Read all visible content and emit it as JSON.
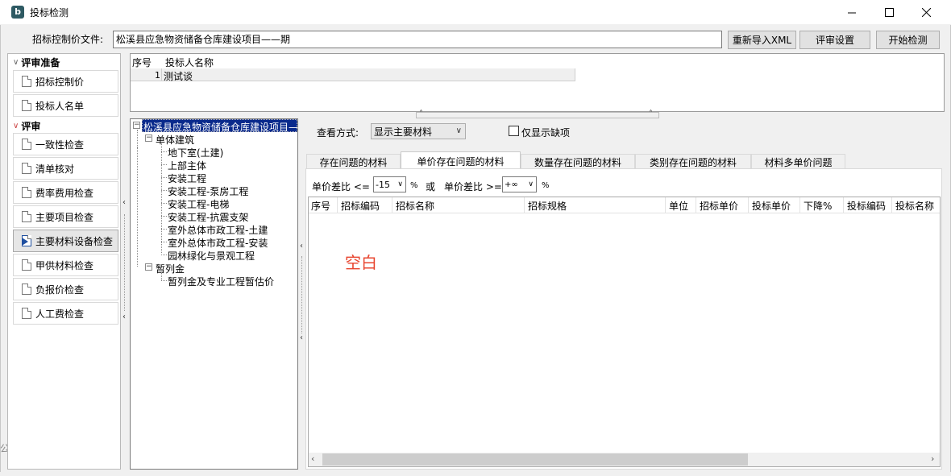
{
  "window": {
    "title": "投标检测",
    "app_icon_letter": "b"
  },
  "file_row": {
    "label": "招标控制价文件:",
    "value": "松溪县应急物资储备仓库建设项目——期",
    "btn_reimport": "重新导入XML",
    "btn_settings": "评审设置",
    "btn_start": "开始检测"
  },
  "leftnav": {
    "section1": "评审准备",
    "section1_items": [
      "招标控制价",
      "投标人名单"
    ],
    "section2": "评审",
    "section2_items": [
      "一致性检查",
      "清单核对",
      "费率费用检查",
      "主要项目检查",
      "主要材料设备检查",
      "甲供材料检查",
      "负报价检查",
      "人工费检查"
    ],
    "active_index": 4
  },
  "topgrid": {
    "headers": [
      "序号",
      "投标人名称"
    ],
    "rows": [
      {
        "seq": "1",
        "name": "测试谈"
      }
    ]
  },
  "tree": {
    "root": "松溪县应急物资储备仓库建设项目—",
    "group1": "单体建筑",
    "group1_items": [
      "地下室(土建)",
      "上部主体",
      "安装工程",
      "安装工程-泵房工程",
      "安装工程-电梯",
      "安装工程-抗震支架",
      "室外总体市政工程-土建",
      "室外总体市政工程-安装",
      "园林绿化与景观工程"
    ],
    "group2": "暂列金",
    "group2_items": [
      "暂列金及专业工程暂估价"
    ]
  },
  "view": {
    "label": "查看方式:",
    "selected": "显示主要材料",
    "only_missing": "仅显示缺项",
    "only_missing_checked": false
  },
  "tabs": [
    "存在问题的材料",
    "单价存在问题的材料",
    "数量存在问题的材料",
    "类别存在问题的材料",
    "材料多单价问题"
  ],
  "active_tab": 1,
  "filter": {
    "label1": "单价差比  <=",
    "value1": "-15",
    "pct": "%",
    "or": "或",
    "label2": "单价差比  >=",
    "value2": "+∞"
  },
  "grid": {
    "headers": [
      "序号",
      "招标编码",
      "招标名称",
      "招标规格",
      "单位",
      "招标单价",
      "投标单价",
      "下降%",
      "投标编码",
      "投标名称"
    ],
    "empty_text": "空白"
  },
  "colors": {
    "selection": "#0a2a8c",
    "empty_text": "#e8452f",
    "active_marker": "#1f4fa0"
  },
  "icons": {
    "app": "app-logo-icon",
    "minimize": "minimize-icon",
    "maximize": "maximize-icon",
    "close": "close-icon",
    "nav_item": "document-icon"
  }
}
